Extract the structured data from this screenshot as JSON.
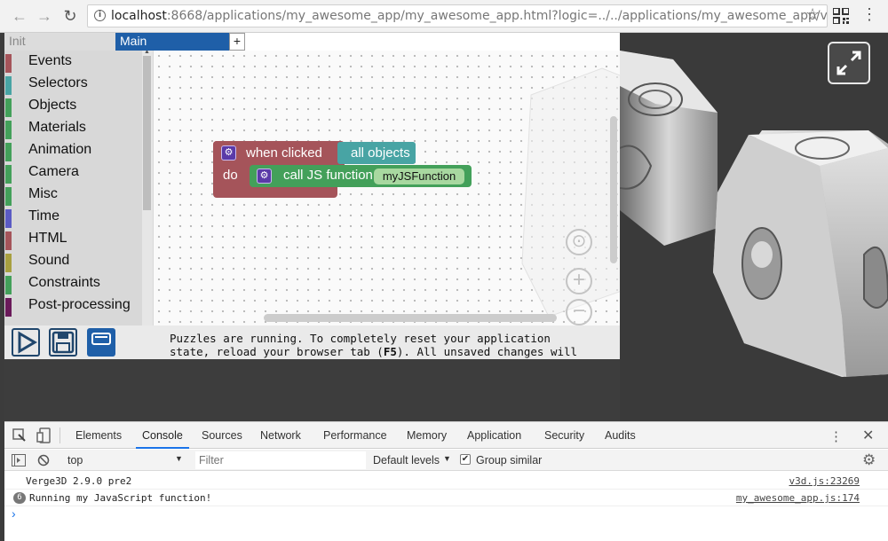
{
  "browser": {
    "url_host": "localhost",
    "url_rest": ":8668/applications/my_awesome_app/my_awesome_app.html?logic=../../applications/my_awesome_app/visual_...",
    "back": "←",
    "forward": "→",
    "reload": "↻",
    "star": "☆",
    "menu": "⋮"
  },
  "editor": {
    "tabs": {
      "init": "Init",
      "main": "Main",
      "add": "+"
    },
    "categories": [
      {
        "label": "Events",
        "color": "#a5545a"
      },
      {
        "label": "Selectors",
        "color": "#48a4a4"
      },
      {
        "label": "Objects",
        "color": "#43a05a"
      },
      {
        "label": "Materials",
        "color": "#43a05a"
      },
      {
        "label": "Animation",
        "color": "#43a05a"
      },
      {
        "label": "Camera",
        "color": "#43a05a"
      },
      {
        "label": "Misc",
        "color": "#43a05a"
      },
      {
        "label": "Time",
        "color": "#5b5bc4"
      },
      {
        "label": "HTML",
        "color": "#a5545a"
      },
      {
        "label": "Sound",
        "color": "#a8a040"
      },
      {
        "label": "Constraints",
        "color": "#43a05a"
      },
      {
        "label": "Post-processing",
        "color": "#6a1a5a"
      }
    ],
    "blocks": {
      "when_clicked": "when clicked",
      "all_objects": "all objects",
      "do": "do",
      "call_js": "call JS function",
      "fn_name": "myJSFunction"
    },
    "zoom": {
      "reset": "⊙",
      "in": "+",
      "out": "−"
    },
    "status_line1": "Puzzles are running. To completely reset your application",
    "status_line2_a": "state, reload your browser tab (",
    "status_line2_key": "F5",
    "status_line2_b": "). All unsaved changes will"
  },
  "devtools": {
    "tabs": [
      "Elements",
      "Console",
      "Sources",
      "Network",
      "Performance",
      "Memory",
      "Application",
      "Security",
      "Audits"
    ],
    "context": "top",
    "filter_placeholder": "Filter",
    "levels": "Default levels",
    "group_similar": "Group similar",
    "logs": [
      {
        "count": "",
        "message": "Verge3D 2.9.0 pre2",
        "source": "v3d.js:23269"
      },
      {
        "count": "6",
        "message": "Running my JavaScript function!",
        "source": "my_awesome_app.js:174"
      }
    ],
    "prompt": "›"
  }
}
